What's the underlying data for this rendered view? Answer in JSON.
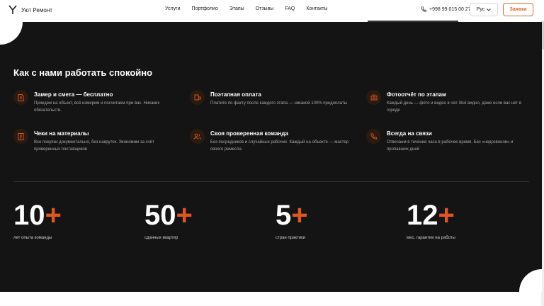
{
  "brand": {
    "name": "Уют Ремонт"
  },
  "nav": [
    "Услуги",
    "Портфолио",
    "Этапы",
    "Отзывы",
    "FAQ",
    "Контакты"
  ],
  "header": {
    "phone": "+998 99 015 00 27",
    "lang": "Рус",
    "cta": "Заявка"
  },
  "section": {
    "title": "Как с нами работать спокойно"
  },
  "features": [
    {
      "icon": "document-icon",
      "title": "Замер и смета — бесплатно",
      "desc": "Приедем на объект, всё измерим и посчитаем при вас. Никаких обязательств."
    },
    {
      "icon": "card-icon",
      "title": "Поэтапная оплата",
      "desc": "Платите по факту после каждого этапа — никакой 100% предоплаты"
    },
    {
      "icon": "camera-icon",
      "title": "Фотоотчёт по этапам",
      "desc": "Каждый день — фото и видео в чат. Всё видно, даже если вас нет в городе"
    },
    {
      "icon": "receipt-icon",
      "title": "Чеки на материалы",
      "desc": "Все покупки документально, без накруток. Экономим за счёт проверенных поставщиков"
    },
    {
      "icon": "team-icon",
      "title": "Своя проверенная команда",
      "desc": "Без посредников и случайных рабочих. Каждый на объекте — мастер своего ремесла"
    },
    {
      "icon": "phone-icon",
      "title": "Всегда на связи",
      "desc": "Отвечаем в течение часа в рабочее время. Без «недозвонов» и пропавших дней"
    }
  ],
  "stats": [
    {
      "num": "10",
      "plus": "+",
      "label": "лет опыта команды"
    },
    {
      "num": "50",
      "plus": "+",
      "label": "сданных квартир"
    },
    {
      "num": "5",
      "plus": "+",
      "label": "стран практики"
    },
    {
      "num": "12",
      "plus": "+",
      "label": "мес. гарантии на работы"
    }
  ],
  "colors": {
    "accent": "#e0571e",
    "dark": "#141414"
  }
}
